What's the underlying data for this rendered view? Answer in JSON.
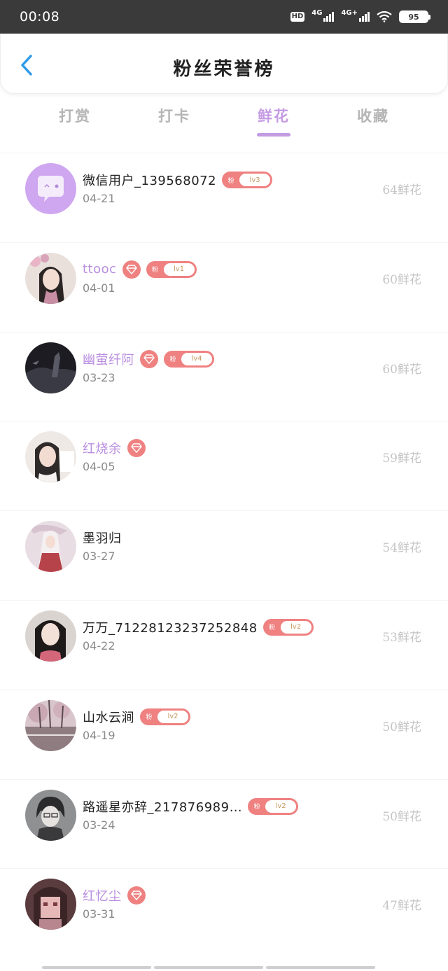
{
  "status": {
    "time": "00:08",
    "hd": "HD",
    "net1": "4G",
    "net2": "4G+",
    "battery": "95"
  },
  "header": {
    "title": "粉丝荣誉榜"
  },
  "tabs": [
    {
      "label": "打赏"
    },
    {
      "label": "打卡"
    },
    {
      "label": "鲜花"
    },
    {
      "label": "收藏"
    }
  ],
  "active_tab": "鲜花",
  "colors": {
    "accent": "#c49be3",
    "badge": "#ef8181",
    "vip_name": "#b98ee0",
    "muted": "#c5c5c5"
  },
  "badge_prefix": "粉",
  "list": [
    {
      "name": "微信用户_139568072",
      "date": "04-21",
      "count": "64鲜花",
      "vip": false,
      "diamond": false,
      "level": "lv3",
      "avatar": "placeholder-chat"
    },
    {
      "name": "ttooc",
      "date": "04-01",
      "count": "60鲜花",
      "vip": true,
      "diamond": true,
      "level": "lv1",
      "avatar": "girl-flowers"
    },
    {
      "name": "幽萤纤阿",
      "date": "03-23",
      "count": "60鲜花",
      "vip": true,
      "diamond": true,
      "level": "lv4",
      "avatar": "dark-figure"
    },
    {
      "name": "红烧余",
      "date": "04-05",
      "count": "59鲜花",
      "vip": true,
      "diamond": true,
      "level": "",
      "avatar": "girl-photo"
    },
    {
      "name": "墨羽归",
      "date": "03-27",
      "count": "54鲜花",
      "vip": false,
      "diamond": false,
      "level": "",
      "avatar": "white-hair"
    },
    {
      "name": "万万_71228123237252848",
      "date": "04-22",
      "count": "53鲜花",
      "vip": false,
      "diamond": false,
      "level": "lv2",
      "avatar": "girl-portrait"
    },
    {
      "name": "山水云涧",
      "date": "04-19",
      "count": "50鲜花",
      "vip": false,
      "diamond": false,
      "level": "lv2",
      "avatar": "landscape"
    },
    {
      "name": "路遥星亦辞_217876989…",
      "date": "03-24",
      "count": "50鲜花",
      "vip": false,
      "diamond": false,
      "level": "lv2",
      "avatar": "anime-boy"
    },
    {
      "name": "红忆尘",
      "date": "03-31",
      "count": "47鲜花",
      "vip": true,
      "diamond": true,
      "level": "",
      "avatar": "pixel-girl"
    }
  ]
}
